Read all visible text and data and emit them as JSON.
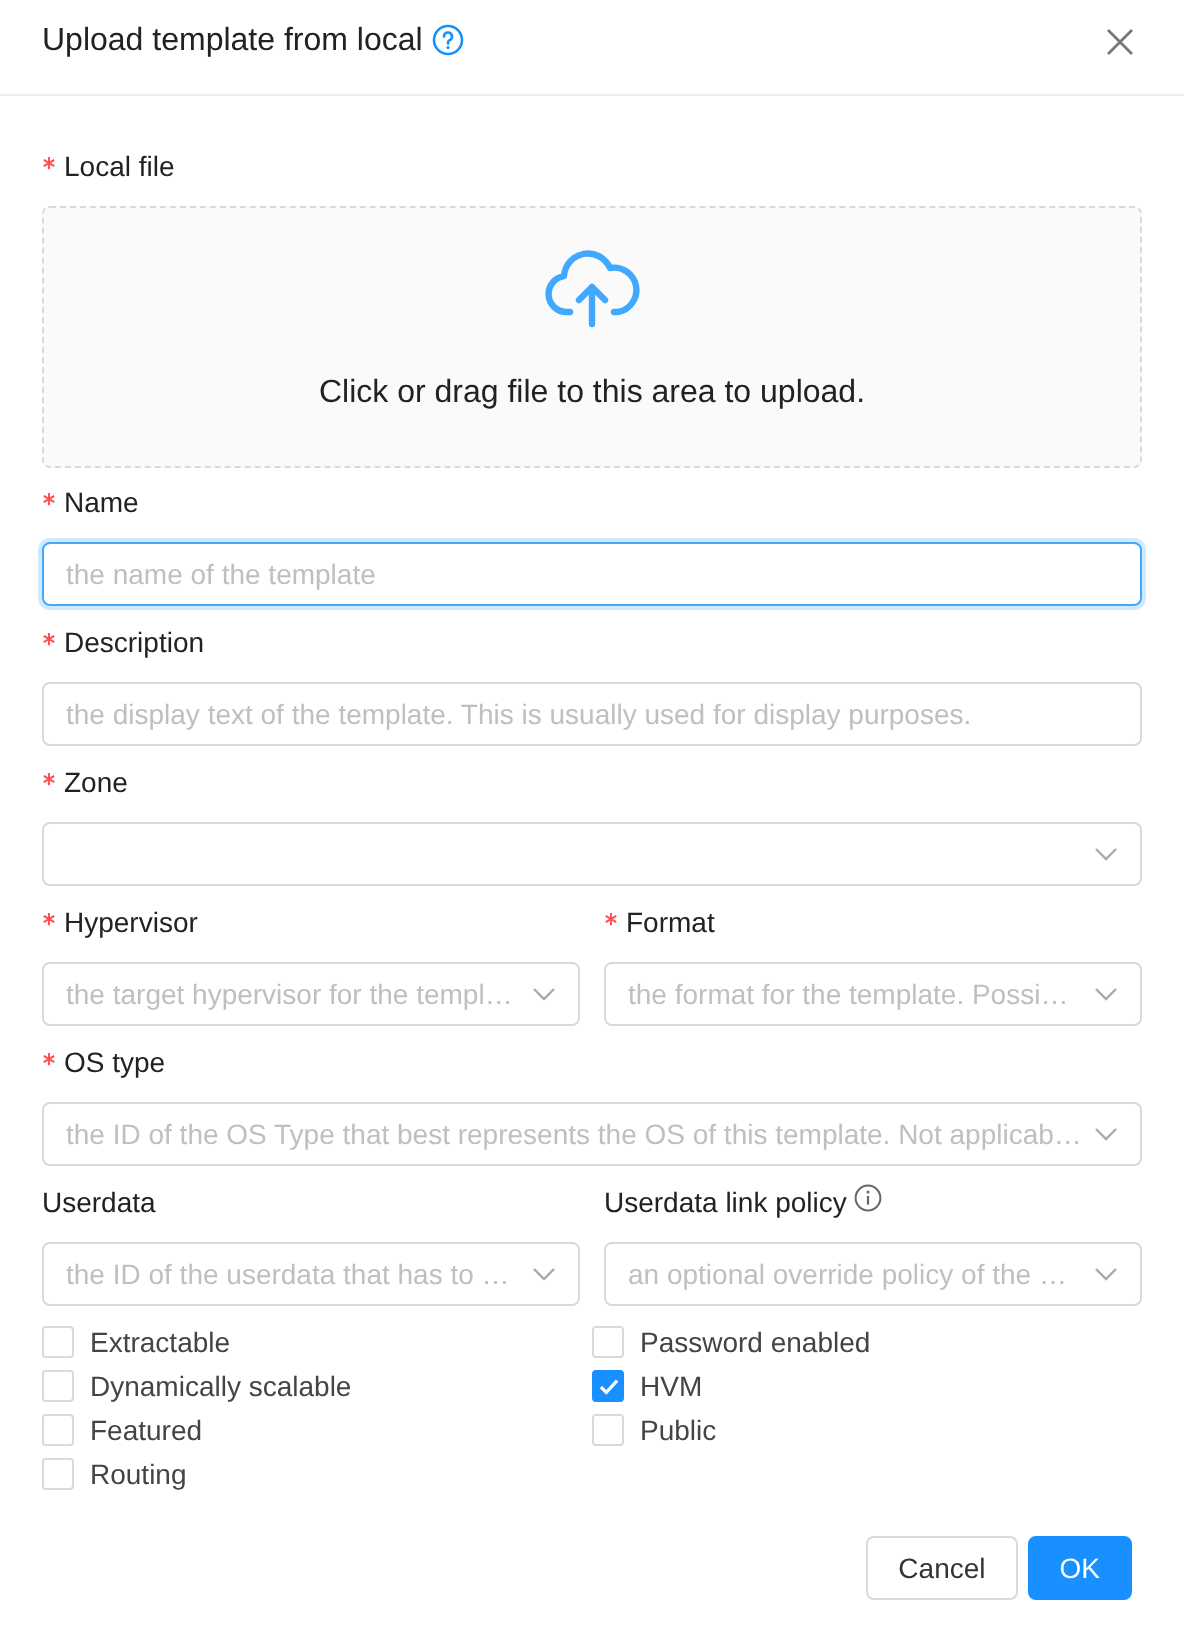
{
  "dialog": {
    "title": "Upload template from local"
  },
  "upload": {
    "label": "Local file",
    "required": true,
    "hint": "Click or drag file to this area to upload."
  },
  "rows": [
    {
      "fields": [
        {
          "label": "Name",
          "required": true,
          "kind": "input",
          "placeholder": "the name of the template",
          "focused": true
        }
      ]
    },
    {
      "fields": [
        {
          "label": "Description",
          "required": true,
          "kind": "input",
          "placeholder": "the display text of the template. This is usually used for display purposes.",
          "focused": false
        }
      ]
    },
    {
      "fields": [
        {
          "label": "Zone",
          "required": true,
          "kind": "select",
          "focused": false
        }
      ]
    },
    {
      "fields": [
        {
          "label": "Hypervisor",
          "required": true,
          "kind": "select",
          "placeholder": "the target hypervisor for the templ…",
          "focused": false
        },
        {
          "label": "Format",
          "required": true,
          "kind": "select",
          "placeholder": "the format for the template. Possi…",
          "focused": false
        }
      ]
    },
    {
      "fields": [
        {
          "label": "OS type",
          "required": true,
          "kind": "select",
          "placeholder": "the ID of the OS Type that best represents the OS of this template. Not applicab…",
          "focused": false
        }
      ]
    },
    {
      "fields": [
        {
          "label": "Userdata",
          "required": false,
          "kind": "select",
          "placeholder": "the ID of the userdata that has to …",
          "focused": false,
          "info": false
        },
        {
          "label": "Userdata link policy",
          "required": false,
          "kind": "select",
          "placeholder": "an optional override policy of the …",
          "focused": false,
          "info": true
        }
      ]
    }
  ],
  "checkboxes": [
    {
      "label": "Extractable",
      "checked": false
    },
    {
      "label": "Password enabled",
      "checked": false
    },
    {
      "label": "Dynamically scalable",
      "checked": false
    },
    {
      "label": "HVM",
      "checked": true
    },
    {
      "label": "Featured",
      "checked": false
    },
    {
      "label": "Public",
      "checked": false
    },
    {
      "label": "Routing",
      "checked": false
    }
  ],
  "buttons": [
    {
      "label": "Cancel",
      "kind": "default"
    },
    {
      "label": "OK",
      "kind": "primary"
    }
  ]
}
